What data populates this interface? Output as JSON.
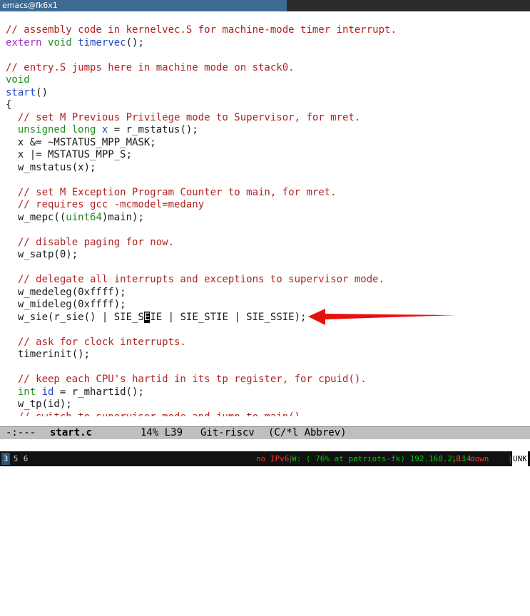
{
  "window": {
    "title": "emacs@fk6x1"
  },
  "code_lines": [
    [
      {
        "t": "// assembly code in kernelvec.S for machine-mode timer interrupt.",
        "c": "cmt"
      }
    ],
    [
      {
        "t": "extern",
        "c": "kw"
      },
      {
        "t": " "
      },
      {
        "t": "void",
        "c": "ty"
      },
      {
        "t": " "
      },
      {
        "t": "timervec",
        "c": "fn"
      },
      {
        "t": "();"
      }
    ],
    [],
    [
      {
        "t": "// entry.S jumps here in machine mode on stack0.",
        "c": "cmt"
      }
    ],
    [
      {
        "t": "void",
        "c": "ty"
      }
    ],
    [
      {
        "t": "start",
        "c": "fn"
      },
      {
        "t": "()"
      }
    ],
    [
      {
        "t": "{"
      }
    ],
    [
      {
        "t": "  "
      },
      {
        "t": "// set M Previous Privilege mode to Supervisor, for mret.",
        "c": "cmt"
      }
    ],
    [
      {
        "t": "  "
      },
      {
        "t": "unsigned long",
        "c": "ty"
      },
      {
        "t": " "
      },
      {
        "t": "x",
        "c": "fn"
      },
      {
        "t": " = r_mstatus();"
      }
    ],
    [
      {
        "t": "  x &= ~MSTATUS_MPP_MASK;"
      }
    ],
    [
      {
        "t": "  x |= MSTATUS_MPP_S;"
      }
    ],
    [
      {
        "t": "  w_mstatus(x);"
      }
    ],
    [],
    [
      {
        "t": "  "
      },
      {
        "t": "// set M Exception Program Counter to main, for mret.",
        "c": "cmt"
      }
    ],
    [
      {
        "t": "  "
      },
      {
        "t": "// requires gcc -mcmodel=medany",
        "c": "cmt"
      }
    ],
    [
      {
        "t": "  w_mepc(("
      },
      {
        "t": "uint64",
        "c": "ty"
      },
      {
        "t": ")main);"
      }
    ],
    [],
    [
      {
        "t": "  "
      },
      {
        "t": "// disable paging for now.",
        "c": "cmt"
      }
    ],
    [
      {
        "t": "  w_satp(0);"
      }
    ],
    [],
    [
      {
        "t": "  "
      },
      {
        "t": "// delegate all interrupts and exceptions to supervisor mode.",
        "c": "cmt"
      }
    ],
    [
      {
        "t": "  w_medeleg(0xffff);"
      }
    ],
    [
      {
        "t": "  w_mideleg(0xffff);"
      }
    ],
    [
      {
        "t": "  w_sie(r_sie() | SIE_S"
      },
      {
        "t": "E",
        "c": "cursor"
      },
      {
        "t": "IE | SIE_STIE | SIE_SSIE);"
      }
    ],
    [],
    [
      {
        "t": "  "
      },
      {
        "t": "// ask for clock interrupts.",
        "c": "cmt"
      }
    ],
    [
      {
        "t": "  timerinit();"
      }
    ],
    [],
    [
      {
        "t": "  "
      },
      {
        "t": "// keep each CPU's hartid in its tp register, for cpuid().",
        "c": "cmt"
      }
    ],
    [
      {
        "t": "  "
      },
      {
        "t": "int",
        "c": "ty"
      },
      {
        "t": " "
      },
      {
        "t": "id",
        "c": "fn"
      },
      {
        "t": " = r_mhartid();"
      }
    ],
    [
      {
        "t": "  w_tp(id);"
      }
    ],
    [
      {
        "t": "  "
      },
      {
        "t": "// switch to supervisor mode and jump to main().",
        "c": "cmt cut"
      }
    ]
  ],
  "modeline": {
    "status": "-:---",
    "buffer": "start.c",
    "position": "14% L39",
    "vc": "Git-riscv",
    "modes": "(C/*l Abbrev)"
  },
  "statusbar": {
    "workspaces": [
      "3",
      "5",
      "6"
    ],
    "ipv6": "no IPv6",
    "sep": "|",
    "wifi": "W: ( 76% at patriots-fk) 192.168.2.114",
    "eth": "E: down",
    "unk": "UNK"
  },
  "colors": {
    "comment": "#b22222",
    "keyword": "#9b30c8",
    "type": "#228b22",
    "function": "#1e44c8",
    "arrow": "#e8100e"
  }
}
